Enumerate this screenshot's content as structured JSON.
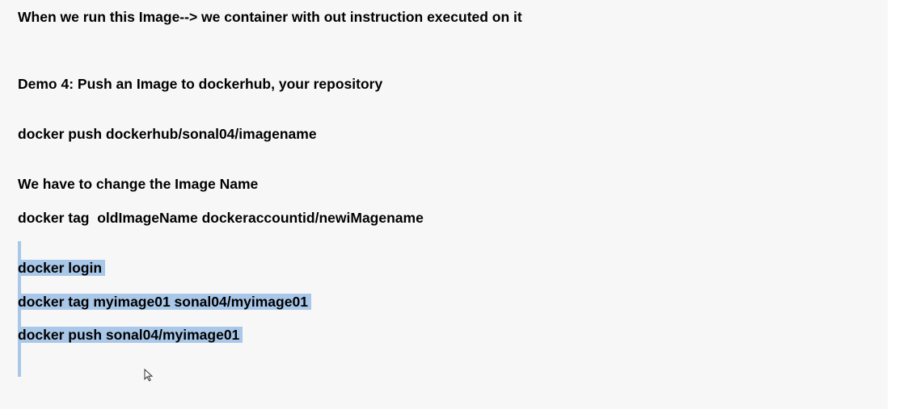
{
  "document": {
    "lines": {
      "intro": "When we run this Image--> we container with out instruction executed on it",
      "demo_heading": "Demo 4: Push an Image to dockerhub, your repository",
      "push_example": "docker push dockerhub/sonal04/imagename",
      "change_name_note": "We have to change the Image Name",
      "tag_syntax": "docker tag  oldImageName dockeraccountid/newiMagename",
      "login_cmd": "docker login",
      "tag_cmd": "docker tag myimage01 sonal04/myimage01",
      "push_cmd": "docker push sonal04/myimage01"
    }
  },
  "selection": {
    "color": "#a9c7e8"
  },
  "cursor": {
    "icon": "mouse-pointer-icon"
  }
}
